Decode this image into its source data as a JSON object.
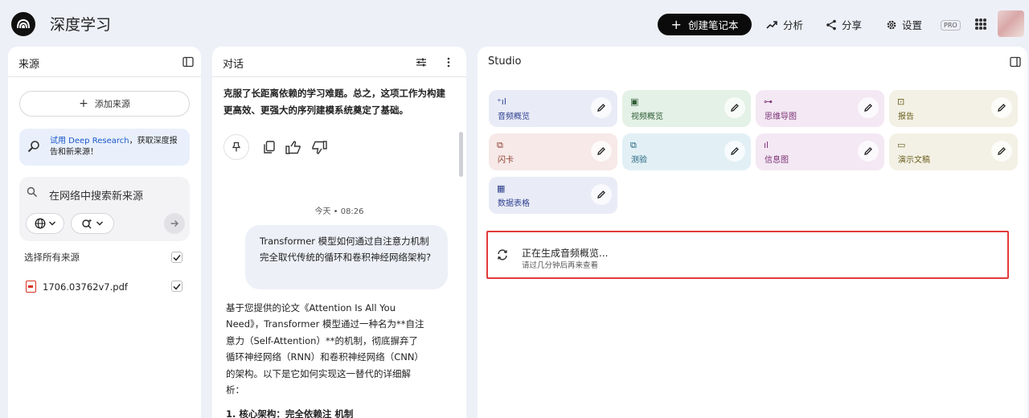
{
  "app": {
    "title": "深度学习",
    "create_label": "创建笔记本",
    "analyze_label": "分析",
    "share_label": "分享",
    "settings_label": "设置",
    "pro_label": "PRO"
  },
  "sources": {
    "title": "来源",
    "add_label": "添加来源",
    "deep_research": {
      "prefix": "试用 Deep Research",
      "text": "，获取深度报告和新来源！"
    },
    "search_placeholder": "在网络中搜索新来源",
    "select_all_label": "选择所有来源",
    "files": [
      {
        "name": "1706.03762v7.pdf",
        "checked": true
      }
    ]
  },
  "chat": {
    "title": "对话",
    "top_text": "克服了长距离依赖的学习难题。总之，这项工作为构建更高效、更强大的序列建模系统奠定了基础。",
    "timestamp": "今天 • 08:26",
    "user_message": "Transformer 模型如何通过自注意力机制完全取代传统的循环和卷积神经网络架构?",
    "answer": "基于您提供的论文《Attention Is All You Need》，Transformer 模型通过一种名为**自注意力（Self-Attention）**的机制，彻底摒弃了循环神经网络（RNN）和卷积神经网络（CNN）的架构。以下是它如何实现这一替代的详细解析：",
    "answer_heading": "1. 核心架构：完全依赖注    机制"
  },
  "studio": {
    "title": "Studio",
    "tiles": [
      {
        "label": "音频概览",
        "icon": "audio-wave-icon",
        "bg": "#e9ecf7",
        "fg": "#2f3f8f"
      },
      {
        "label": "视频概览",
        "icon": "video-icon",
        "bg": "#e4f1e6",
        "fg": "#2f5e36"
      },
      {
        "label": "思维导图",
        "icon": "mindmap-icon",
        "bg": "#f3e8f3",
        "fg": "#7b3176"
      },
      {
        "label": "报告",
        "icon": "report-icon",
        "bg": "#f3f1e5",
        "fg": "#6b5e1e"
      },
      {
        "label": "闪卡",
        "icon": "flashcard-icon",
        "bg": "#f6e9e7",
        "fg": "#8c3a2e"
      },
      {
        "label": "测验",
        "icon": "quiz-icon",
        "bg": "#e2f0f6",
        "fg": "#1f5f7a"
      },
      {
        "label": "信息图",
        "icon": "infographic-icon",
        "bg": "#f3e8f3",
        "fg": "#7b3176"
      },
      {
        "label": "演示文稿",
        "icon": "slides-icon",
        "bg": "#f3f1e5",
        "fg": "#6b5e1e"
      },
      {
        "label": "数据表格",
        "icon": "table-icon",
        "bg": "#e9ecf7",
        "fg": "#2f3f8f"
      }
    ],
    "generating": {
      "title": "正在生成音频概览...",
      "subtitle": "请过几分钟后再来查看"
    }
  }
}
